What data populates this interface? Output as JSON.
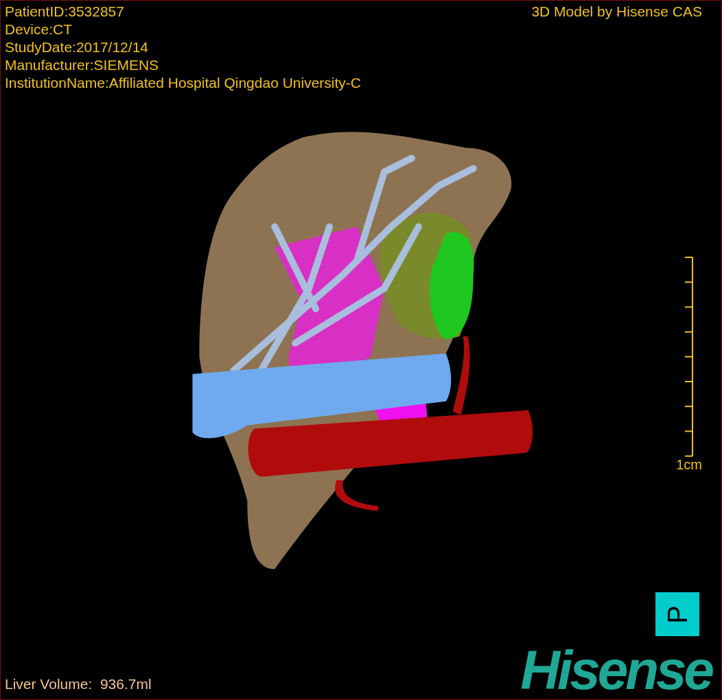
{
  "info_lines": [
    "PatientID:3532857",
    "Device:CT",
    "StudyDate:2017/12/14",
    "Manufacturer:SIEMENS",
    "InstitutionName:Affiliated Hospital Qingdao University-C"
  ],
  "title": "3D Model by Hisense CAS",
  "scale_bar": {
    "label": "1cm"
  },
  "orientation_marker": "P",
  "liver_volume": "Liver Volume:  936.7ml",
  "logo": "Hisense"
}
